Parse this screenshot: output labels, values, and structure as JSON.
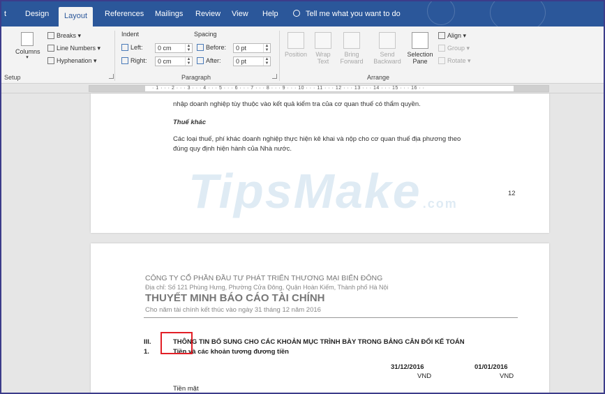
{
  "tabs": {
    "file_partial": "t",
    "design": "Design",
    "layout": "Layout",
    "references": "References",
    "mailings": "Mailings",
    "review": "Review",
    "view": "View",
    "help": "Help",
    "tell_me": "Tell me what you want to do"
  },
  "ribbon": {
    "columns": "Columns",
    "breaks": "Breaks",
    "line_numbers": "Line Numbers",
    "hyphenation": "Hyphenation",
    "setup_label": "Setup",
    "indent_header": "Indent",
    "spacing_header": "Spacing",
    "left_label": "Left:",
    "left_value": "0 cm",
    "right_label": "Right:",
    "right_value": "0 cm",
    "before_label": "Before:",
    "before_value": "0 pt",
    "after_label": "After:",
    "after_value": "0 pt",
    "paragraph_label": "Paragraph",
    "position": "Position",
    "wrap_text": "Wrap Text",
    "bring_forward": "Bring Forward",
    "send_backward": "Send Backward",
    "selection_pane": "Selection Pane",
    "align": "Align",
    "group": "Group",
    "rotate": "Rotate",
    "arrange_label": "Arrange"
  },
  "page1": {
    "line1": "nhập doanh nghiệp tùy thuộc vào kết quả kiểm tra của cơ quan thuế có thẩm quyền.",
    "heading": "Thuế khác",
    "para1": "Các loại thuế, phí khác doanh nghiệp thực hiện kê khai và nộp cho cơ quan thuế địa phương theo",
    "para2": "đúng quy định hiện hành của Nhà nước.",
    "page_number": "12",
    "watermark_main": "TipsMake",
    "watermark_com": ".com"
  },
  "page2": {
    "company": "CÔNG TY CỔ PHẦN ĐẦU TƯ PHÁT TRIỂN THƯƠNG MẠI BIỂN ĐÔNG",
    "address": "Địa chỉ: Số 121 Phùng Hưng, Phường Cửa Đông, Quận Hoàn Kiếm, Thành phố Hà Nội",
    "title": "THUYẾT MINH BÁO CÁO TÀI CHÍNH",
    "subtitle": "Cho năm tài chính kết thúc vào ngày 31 tháng 12 năm 2016",
    "section_num": "III.",
    "section_title": "THÔNG TIN BỔ SUNG CHO CÁC KHOẢN MỤC TRÌNH BÀY TRONG BẢNG CÂN ĐỐI KẾ TOÁN",
    "item_num": "1.",
    "item_title": "Tiền và các khoản tương đương tiền",
    "col1_date": "31/12/2016",
    "col1_unit": "VND",
    "col2_date": "01/01/2016",
    "col2_unit": "VND",
    "row1": "Tiền mặt"
  },
  "colors": {
    "ribbon_blue": "#2b579a",
    "highlight_red": "#e21f26"
  }
}
